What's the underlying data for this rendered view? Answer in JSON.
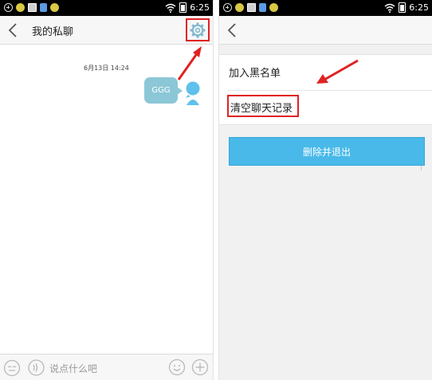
{
  "status_bar": {
    "time": "6:25",
    "left_icons": [
      "plus-circle-icon",
      "smiley-icon",
      "image-icon",
      "book-icon",
      "smiley-icon"
    ],
    "right_icons": [
      "wifi-icon",
      "battery-icon"
    ]
  },
  "left_screen": {
    "title": "我的私聊",
    "message": {
      "timestamp": "6月13日 14:24",
      "text": "GGG"
    },
    "input": {
      "placeholder": "说点什么吧"
    }
  },
  "right_screen": {
    "menu": {
      "blacklist_label": "加入黑名单",
      "clear_history_label": "清空聊天记录"
    },
    "delete_button_label": "删除并退出"
  },
  "colors": {
    "highlight": "#e02222",
    "bubble": "#8cc7d7",
    "button": "#48b9e9"
  }
}
